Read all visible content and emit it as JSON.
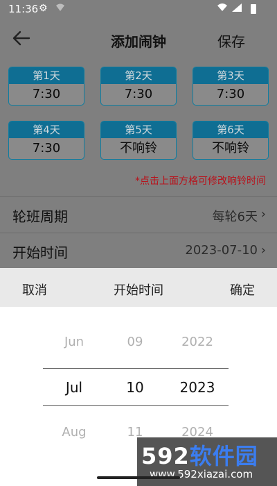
{
  "status_bar": {
    "time": "11:36"
  },
  "header": {
    "title": "添加闹钟",
    "save_label": "保存"
  },
  "days": [
    {
      "label": "第1天",
      "value": "7:30"
    },
    {
      "label": "第2天",
      "value": "7:30"
    },
    {
      "label": "第3天",
      "value": "7:30"
    },
    {
      "label": "第4天",
      "value": "7:30"
    },
    {
      "label": "第5天",
      "value": "不响铃"
    },
    {
      "label": "第6天",
      "value": "不响铃"
    }
  ],
  "hint": "*点击上面方格可修改响铃时间",
  "rows": [
    {
      "label": "轮班周期",
      "value": "每轮6天"
    },
    {
      "label": "开始时间",
      "value": "2023-07-10"
    }
  ],
  "picker": {
    "cancel": "取消",
    "title": "开始时间",
    "confirm": "确定",
    "month": {
      "prev": "Jun",
      "current": "Jul",
      "next": "Aug"
    },
    "day": {
      "prev": "09",
      "current": "10",
      "next": "11"
    },
    "year": {
      "prev": "2022",
      "current": "2023",
      "next": "2024"
    }
  },
  "watermark": {
    "brand_digits": "592",
    "brand_text": "软件园",
    "url": "www.592xiazai.com"
  },
  "colors": {
    "accent": "#0f6e93",
    "hint": "#b8121b",
    "overlay": "#7f7f7f"
  }
}
